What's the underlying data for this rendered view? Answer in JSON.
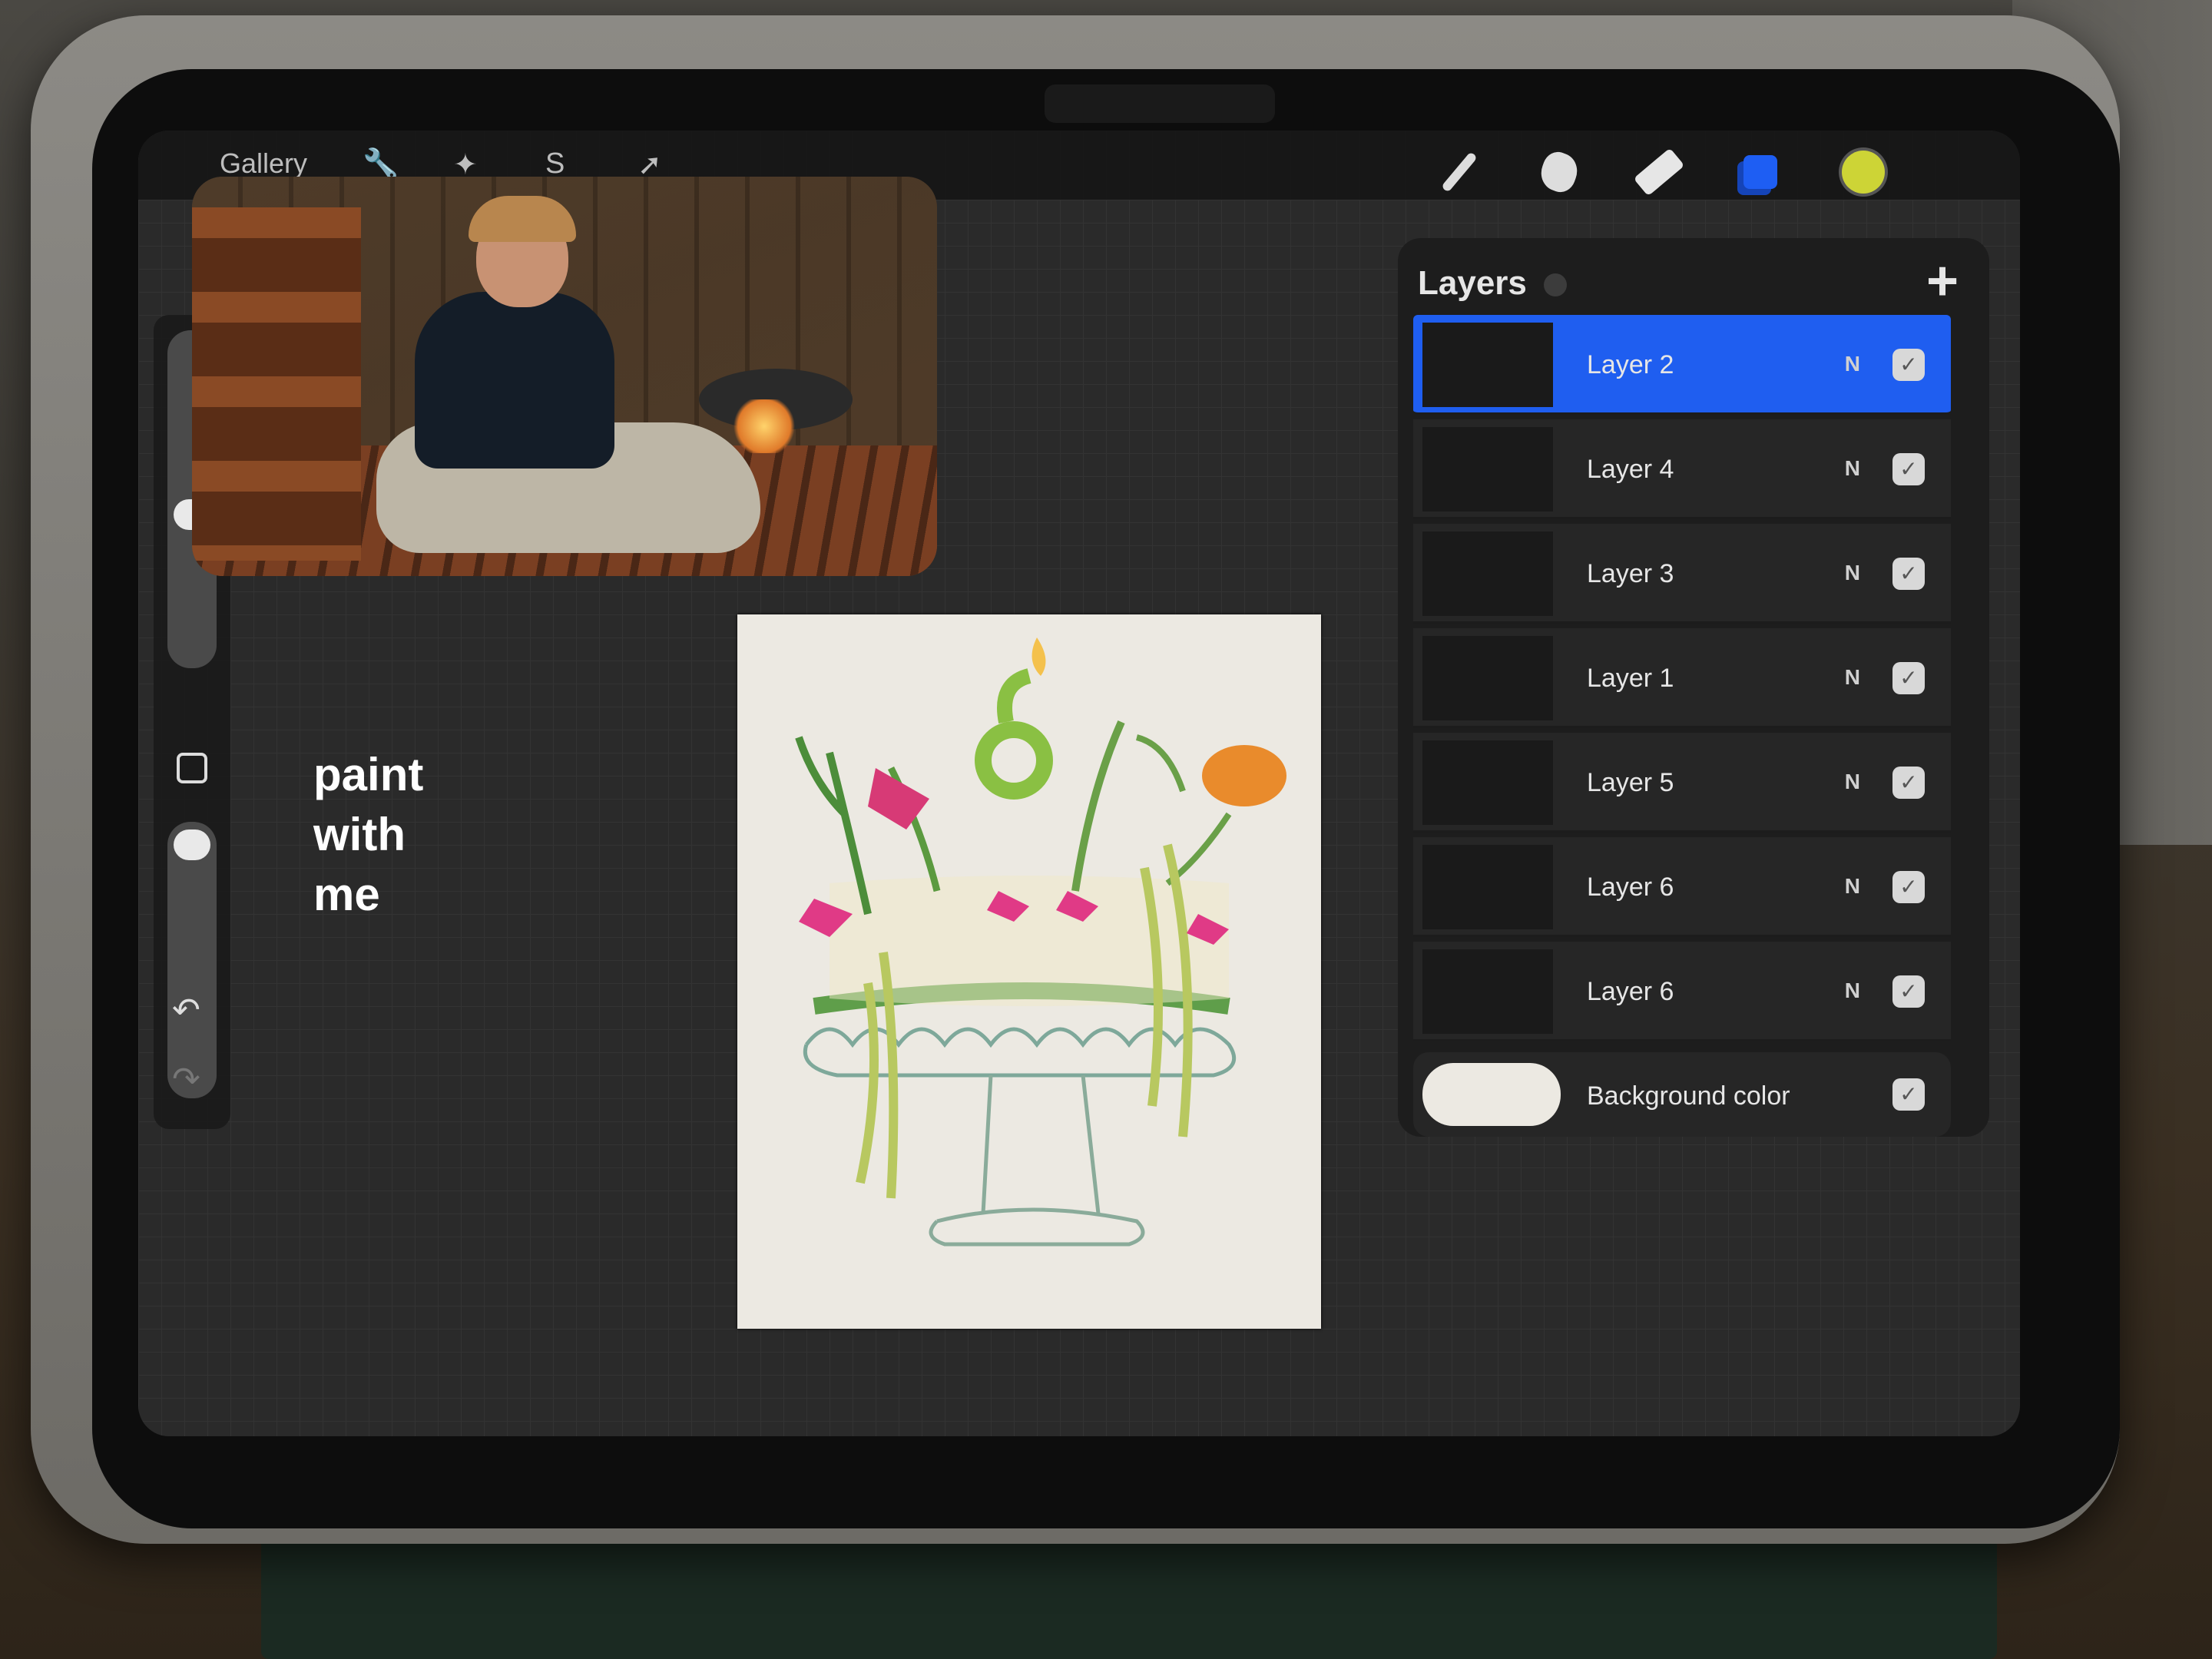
{
  "toolbar": {
    "gallery_label": "Gallery",
    "actions": [
      {
        "name": "wrench-icon",
        "glyph": "🔧"
      },
      {
        "name": "magic-wand-icon",
        "glyph": "✦"
      },
      {
        "name": "selection-icon",
        "glyph": "S"
      },
      {
        "name": "transform-arrow-icon",
        "glyph": "➚"
      }
    ],
    "tools": [
      {
        "name": "brush-tool-icon"
      },
      {
        "name": "smudge-tool-icon"
      },
      {
        "name": "eraser-tool-icon"
      },
      {
        "name": "layers-tool-icon",
        "color": "#1e5ef3"
      },
      {
        "name": "color-picker-icon",
        "color": "#cdd436"
      }
    ]
  },
  "sidebar": {
    "undo_glyph": "↶",
    "redo_glyph": "↷"
  },
  "overlay": {
    "lines": [
      "paint",
      "with",
      "me"
    ]
  },
  "layers_panel": {
    "title": "Layers",
    "add_glyph": "+",
    "layers": [
      {
        "name": "Layer 2",
        "mode": "N",
        "visible": true,
        "active": true
      },
      {
        "name": "Layer 4",
        "mode": "N",
        "visible": true,
        "active": false
      },
      {
        "name": "Layer 3",
        "mode": "N",
        "visible": true,
        "active": false
      },
      {
        "name": "Layer 1",
        "mode": "N",
        "visible": true,
        "active": false
      },
      {
        "name": "Layer 5",
        "mode": "N",
        "visible": true,
        "active": false
      },
      {
        "name": "Layer 6",
        "mode": "N",
        "visible": true,
        "active": false
      },
      {
        "name": "Layer 6",
        "mode": "N",
        "visible": true,
        "active": false
      }
    ],
    "background": {
      "label": "Background color",
      "color": "#ece9e2",
      "visible": true
    },
    "check_glyph": "✓"
  },
  "colors": {
    "accent": "#1f5ef0",
    "canvas": "#ece9e2"
  }
}
